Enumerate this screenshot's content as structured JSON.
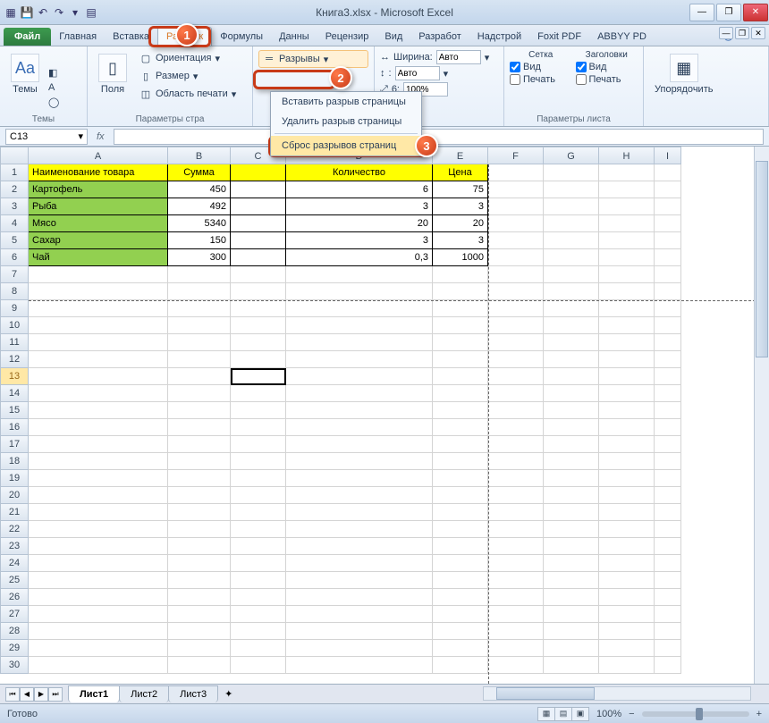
{
  "titlebar": {
    "title": "Книга3.xlsx - Microsoft Excel"
  },
  "ribbon_tabs": {
    "file": "Файл",
    "items": [
      "Главная",
      "Вставка",
      "Разметк",
      "Формулы",
      "Данны",
      "Рецензир",
      "Вид",
      "Разработ",
      "Надстрой",
      "Foxit PDF",
      "ABBYY PD"
    ],
    "active_index": 2
  },
  "ribbon": {
    "themes_group": {
      "title": "Темы",
      "themes": "Темы"
    },
    "page_setup_group": {
      "title": "Параметры стра",
      "margins": "Поля",
      "orientation": "Ориентация",
      "size": "Размер",
      "print_area": "Область печати",
      "breaks": "Разрывы"
    },
    "scale_group": {
      "width_label": "Ширина:",
      "width_val": "Авто",
      "height_label": "",
      "height_val": "Авто",
      "scale_label": "6:",
      "scale_val": "100%"
    },
    "sheet_opts_group": {
      "title": "Параметры листа",
      "grid_title": "Сетка",
      "headings_title": "Заголовки",
      "view": "Вид",
      "print": "Печать"
    },
    "arrange_group": {
      "arrange": "Упорядочить"
    }
  },
  "dropdown": {
    "items": [
      "Вставить разрыв страницы",
      "Удалить разрыв страницы",
      "Сброс разрывов страниц"
    ]
  },
  "namebox": "C13",
  "columns": [
    "A",
    "B",
    "C",
    "D",
    "E",
    "F",
    "G",
    "H",
    "I"
  ],
  "table": {
    "headers": {
      "name": "Наименование товара",
      "sum": "Сумма",
      "qty": "Количество",
      "price": "Цена"
    },
    "rows": [
      {
        "name": "Картофель",
        "sum": "450",
        "qty": "6",
        "price": "75"
      },
      {
        "name": "Рыба",
        "sum": "492",
        "qty": "3",
        "price": "3"
      },
      {
        "name": "Мясо",
        "sum": "5340",
        "qty": "20",
        "price": "20"
      },
      {
        "name": "Сахар",
        "sum": "150",
        "qty": "3",
        "price": "3"
      },
      {
        "name": "Чай",
        "sum": "300",
        "qty": "0,3",
        "price": "1000"
      }
    ]
  },
  "sheet_tabs": [
    "Лист1",
    "Лист2",
    "Лист3"
  ],
  "statusbar": {
    "ready": "Готово",
    "zoom": "100%"
  },
  "callouts": {
    "c1": "1",
    "c2": "2",
    "c3": "3"
  }
}
